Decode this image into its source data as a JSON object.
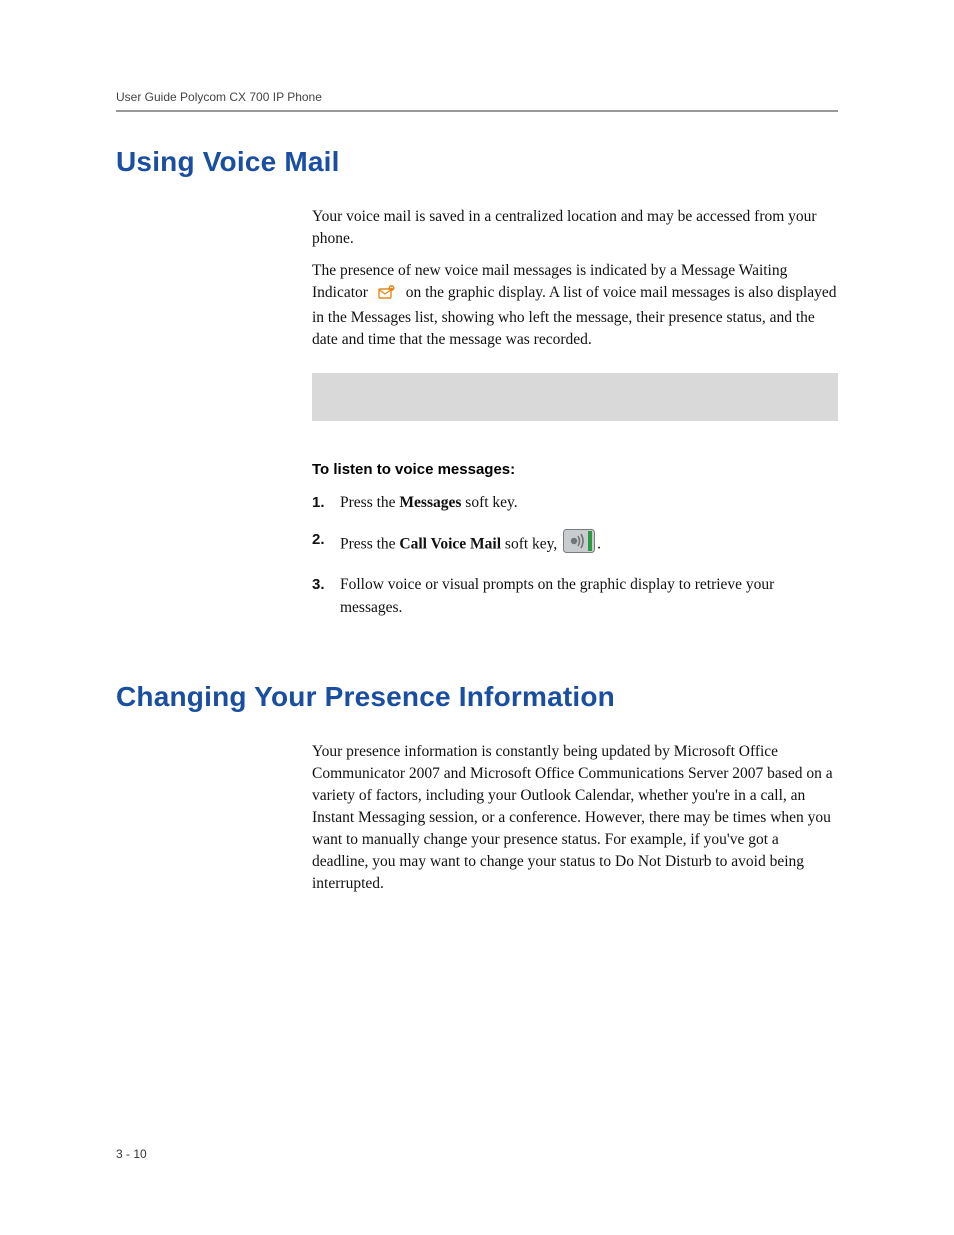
{
  "header": {
    "title": "User Guide Polycom CX 700 IP Phone"
  },
  "section1": {
    "heading": "Using Voice Mail",
    "p1": "Your voice mail is saved in a centralized location and may be accessed from your phone.",
    "p2a": "The presence of new voice mail messages is indicated by a Message Waiting Indicator",
    "p2b": "on the graphic display. A list of voice mail messages is also displayed in the Messages list, showing who left the message, their presence status, and the date and time that the message was recorded.",
    "subhead": "To listen to voice messages:",
    "steps": {
      "s1a": "Press the ",
      "s1b": "Messages",
      "s1c": " soft key.",
      "s2a": "Press the ",
      "s2b": "Call Voice Mail",
      "s2c": " soft key,",
      "s2d": ".",
      "s3": "Follow voice or visual prompts on the graphic display to retrieve your messages."
    }
  },
  "section2": {
    "heading": "Changing Your Presence Information",
    "p1": "Your presence information is constantly being updated by Microsoft Office Communicator 2007 and Microsoft Office Communications Server 2007 based on a variety of factors, including your Outlook Calendar, whether you're in a call, an Instant Messaging session, or a conference. However, there may be times when you want to manually change your presence status. For example, if you've got a deadline, you may want to change your status to Do Not Disturb to avoid being interrupted."
  },
  "footer": {
    "page": "3 - 10"
  }
}
